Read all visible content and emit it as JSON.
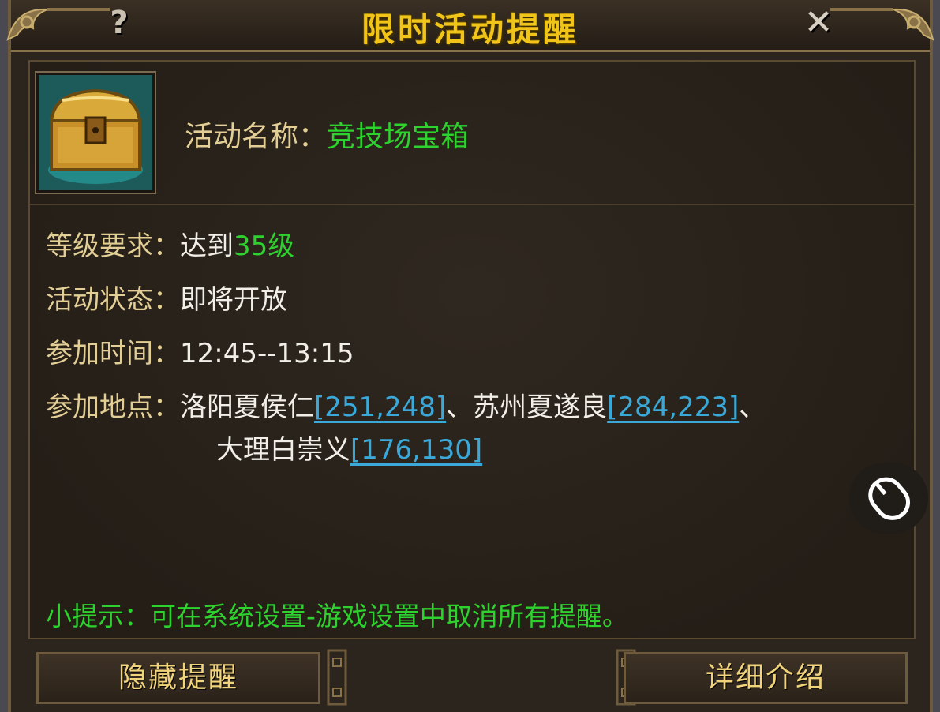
{
  "dialog": {
    "title": "限时活动提醒",
    "help_glyph": "?",
    "close_glyph": "✕"
  },
  "activity": {
    "icon": "treasure-chest-icon",
    "name_label": "活动名称：",
    "name_value": "竞技场宝箱"
  },
  "details": {
    "level": {
      "label": "等级要求：",
      "prefix": "达到",
      "value": "35级"
    },
    "status": {
      "label": "活动状态：",
      "value": "即将开放"
    },
    "time": {
      "label": "参加时间：",
      "value": "12:45--13:15"
    },
    "location": {
      "label": "参加地点：",
      "places": [
        {
          "name": "洛阳夏侯仁",
          "coord": "[251,248]",
          "sep": "、"
        },
        {
          "name": "苏州夏遂良",
          "coord": "[284,223]",
          "sep": "、"
        },
        {
          "name": "大理白崇义",
          "coord": "[176,130]",
          "sep": ""
        }
      ]
    }
  },
  "tip": "小提示：可在系统设置-游戏设置中取消所有提醒。",
  "buttons": {
    "hide": "隐藏提醒",
    "details": "详细介绍"
  },
  "colors": {
    "title": "#f0c419",
    "label": "#e3cf95",
    "highlight_green": "#2ed22e",
    "link": "#3aa8d8"
  },
  "overlay_icon": "mouse-icon"
}
